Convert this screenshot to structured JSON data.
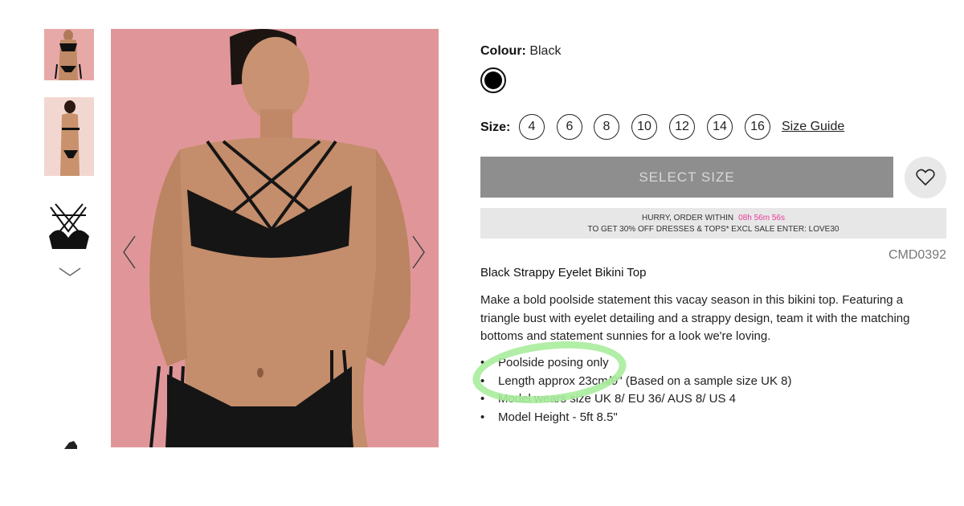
{
  "gallery": {
    "thumbnails": [
      "bikini-front-thumbnail",
      "bikini-back-thumbnail",
      "bikini-top-flatlay-thumbnail",
      "more-thumbnail"
    ],
    "main_image": "model-wearing-black-strappy-bikini"
  },
  "colour": {
    "label": "Colour:",
    "value": "Black",
    "swatch_color": "#000000"
  },
  "size": {
    "label": "Size:",
    "options": [
      "4",
      "6",
      "8",
      "10",
      "12",
      "14",
      "16"
    ],
    "guide_label": "Size Guide"
  },
  "cta": {
    "select_size_label": "SELECT SIZE",
    "button_color": "#8e8e8e"
  },
  "promo": {
    "line1": "HURRY, ORDER WITHIN",
    "timer": "08h 56m 56s",
    "line2": "TO GET 30% OFF DRESSES & TOPS* EXCL SALE ENTER: LOVE30",
    "timer_color": "#e83a9a"
  },
  "product": {
    "sku": "CMD0392",
    "title": "Black Strappy Eyelet Bikini Top",
    "description": "Make a bold poolside statement this vacay season in this bikini top. Featuring a triangle bust with eyelet detailing and a strappy design, team it with the matching bottoms and statement sunnies for a look we're loving.",
    "bullets": [
      "Poolside posing only",
      "Length approx 23cm/9\" (Based on a sample size UK 8)",
      "Model wears size UK 8/ EU 36/ AUS 8/ US 4",
      "Model Height - 5ft 8.5\""
    ]
  },
  "annotation": {
    "highlight_color": "#a9ec9c"
  }
}
